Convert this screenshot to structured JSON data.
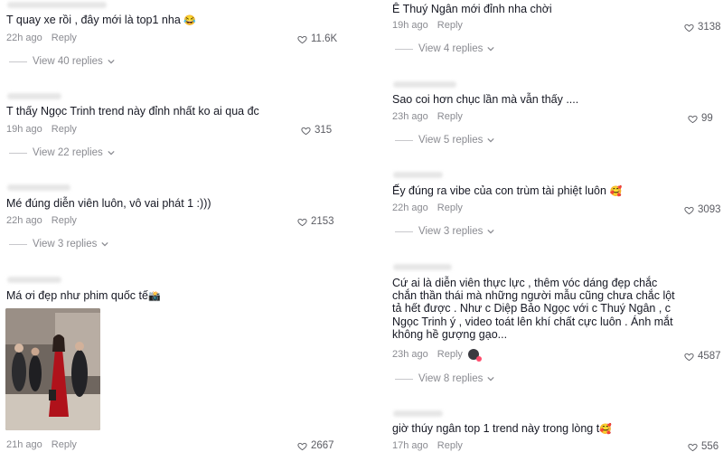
{
  "left": [
    {
      "text": "T quay xe rồi , đây mới là top1 nha",
      "emoji": "😂",
      "time": "22h ago",
      "reply": "Reply",
      "likes": "11.6K",
      "view": "View 40 replies"
    },
    {
      "text": "T thấy Ngọc Trinh trend này đỉnh nhất ko ai qua đc",
      "time": "19h ago",
      "reply": "Reply",
      "likes": "315",
      "view": "View 22 replies"
    },
    {
      "text": "Mé đúng diễn viên luôn, vô vai phát 1 :)))",
      "time": "22h ago",
      "reply": "Reply",
      "likes": "2153",
      "view": "View 3 replies"
    },
    {
      "text": "Má ơi đẹp như phim quốc tế",
      "emoji": "📸",
      "time": "21h ago",
      "reply": "Reply",
      "likes": "2667"
    }
  ],
  "right": [
    {
      "text": "Ê Thuý Ngân mới đỉnh nha chời",
      "time": "19h ago",
      "reply": "Reply",
      "likes": "3138",
      "view": "View 4 replies"
    },
    {
      "text": "Sao coi hơn chục lần mà vẫn thấy ....",
      "time": "23h ago",
      "reply": "Reply",
      "likes": "99",
      "view": "View 5 replies"
    },
    {
      "text": "Ếy đúng ra vibe của con trùm tài phiệt luôn",
      "emoji": "🥰",
      "time": "22h ago",
      "reply": "Reply",
      "likes": "3093",
      "view": "View 3 replies"
    },
    {
      "text": "Cứ ai là diễn viên thực lực , thêm vóc dáng đẹp chắc chắn thần thái mà những người mẫu cũng chưa chắc lột tả hết được . Như c Diệp Bảo Ngọc với c Thuý Ngân , c Ngọc Trinh ý , video toát lên khí chất cực luôn . Ánh mắt không hề gượng gạo...",
      "time": "23h ago",
      "reply": "Reply",
      "likes": "4587",
      "view": "View 8 replies"
    },
    {
      "text": "giờ thúy ngân top 1 trend này trong lòng t",
      "emoji": "🥰",
      "time": "17h ago",
      "reply": "Reply",
      "likes": "556"
    }
  ]
}
